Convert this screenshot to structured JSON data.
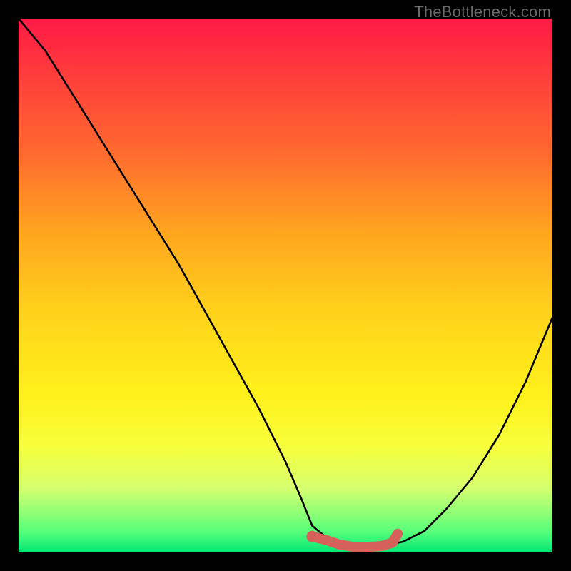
{
  "watermark": "TheBottleneck.com",
  "chart_data": {
    "type": "line",
    "title": "",
    "xlabel": "",
    "ylabel": "",
    "xlim": [
      0,
      100
    ],
    "ylim": [
      0,
      100
    ],
    "series": [
      {
        "name": "bottleneck-curve",
        "x": [
          0,
          5,
          10,
          15,
          20,
          25,
          30,
          35,
          40,
          45,
          50,
          53,
          55,
          58,
          60,
          63,
          65,
          68,
          72,
          76,
          80,
          85,
          90,
          95,
          100
        ],
        "y": [
          100,
          94,
          86,
          78,
          70,
          62,
          54,
          45,
          36,
          27,
          17,
          10,
          5,
          2.5,
          1.5,
          1,
          1,
          1.2,
          2,
          4,
          8,
          14,
          22,
          32,
          44
        ]
      },
      {
        "name": "optimal-zone-highlight",
        "x": [
          55,
          58,
          60,
          63,
          65,
          68,
          70,
          71
        ],
        "y": [
          3,
          2.2,
          1.5,
          1,
          1,
          1.2,
          1.8,
          3.5
        ]
      }
    ],
    "annotations": []
  },
  "colors": {
    "curve": "#000000",
    "highlight": "#d6605a",
    "background_top": "#ff1a47",
    "background_bottom": "#00e676"
  }
}
